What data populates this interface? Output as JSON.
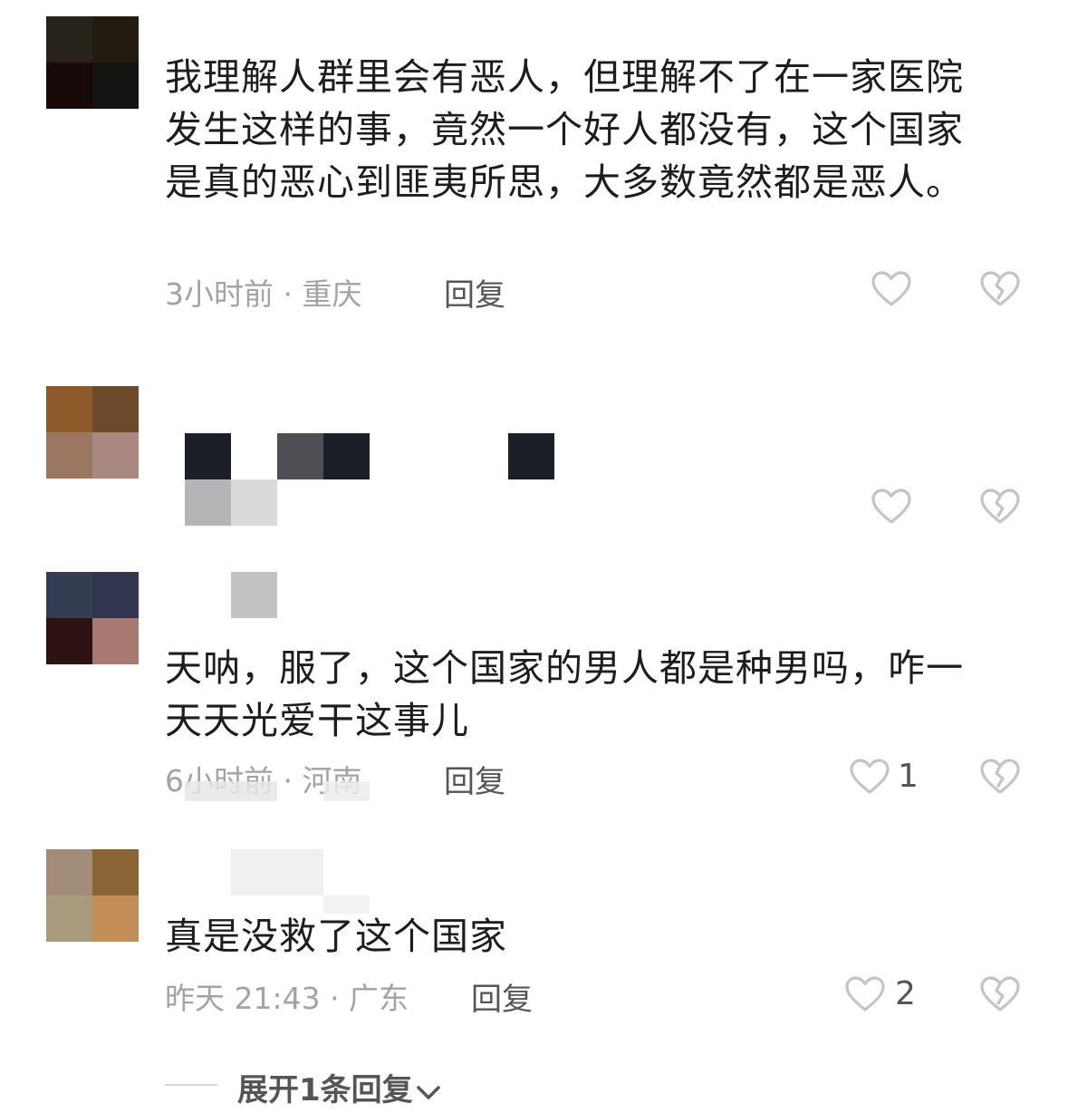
{
  "comments": [
    {
      "text": "我理解人群里会有恶人，但理解不了在一家医院发生这样的事，竟然一个好人都没有，这个国家是真的恶心到匪夷所思，大多数竟然都是恶人。",
      "time_location": "3小时前 · 重庆",
      "reply_label": "回复",
      "like_count": "",
      "avatar_colors": [
        "#27231a",
        "#231a12",
        "#170a08",
        "#141512"
      ]
    },
    {
      "text": "",
      "time_location": "",
      "reply_label": "",
      "like_count": "",
      "avatar_colors": [
        "#8f5a2a",
        "#6e4a2c",
        "#9b7660",
        "#a88880"
      ]
    },
    {
      "text": "天呐，服了，这个国家的男人都是种男吗，咋一天天光爱干这事儿",
      "time_location": "6小时前 · 河南",
      "reply_label": "回复",
      "like_count": "1",
      "avatar_colors": [
        "#353d52",
        "#333651",
        "#2c1210",
        "#a87a72"
      ]
    },
    {
      "text": "真是没救了这个国家",
      "time_location": "昨天 21:43 · 广东",
      "reply_label": "回复",
      "like_count": "2",
      "avatar_colors": [
        "#a08c78",
        "#8a6434",
        "#a89a7c",
        "#c48e58"
      ]
    }
  ],
  "expand_label": "展开1条回复",
  "colors": {
    "text": "#1d1d1d",
    "meta": "#a3a3a3",
    "action": "#555555",
    "icon": "#c4c4c4"
  },
  "icons": {
    "like": "heart-outline-icon",
    "dislike": "broken-heart-icon",
    "expand": "chevron-down-icon"
  }
}
